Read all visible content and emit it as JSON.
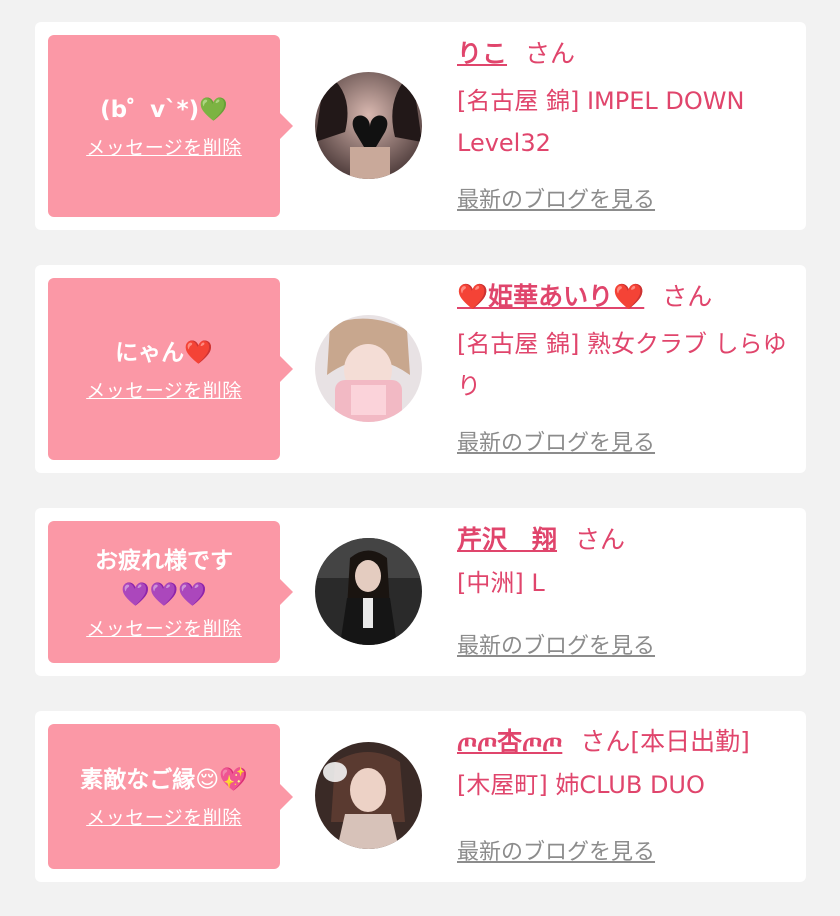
{
  "colors": {
    "accent": "#e0456c",
    "bubble": "#fb98a6",
    "link_gray": "#8c8c8c",
    "background": "#f2f2f2"
  },
  "delete_label": "メッセージを削除",
  "blog_label": "最新のブログを見る",
  "san_label": "さん",
  "entries": [
    {
      "message": "(b゜v`*)💚",
      "name": "りこ",
      "shop": "[名古屋 錦] IMPEL DOWN Level32",
      "avatar": "heart-covered-face-photo"
    },
    {
      "message": "にゃん❤️",
      "name": "❤️姫華あいり❤️",
      "shop": "[名古屋 錦] 熟女クラブ しらゆり",
      "avatar": "towel-face-photo"
    },
    {
      "message": "お疲れ様です💜💜💜",
      "name": "芹沢　翔",
      "shop": "[中洲] L",
      "avatar": "dark-portrait-photo"
    },
    {
      "message": "素敵なご縁😌💖",
      "name": "ﾟ̥̥̥̥̥̥̥ ̥̥ ̥ﾟ杏ﾟ̥̥̥̥̥̥̥ ̥̥ ̥ﾟ",
      "name_display": "ጦጦ杏ጦጦ",
      "san_suffix": "さん[本日出勤]",
      "shop": "[木屋町] 姉CLUB DUO",
      "avatar": "soft-portrait-photo"
    }
  ]
}
